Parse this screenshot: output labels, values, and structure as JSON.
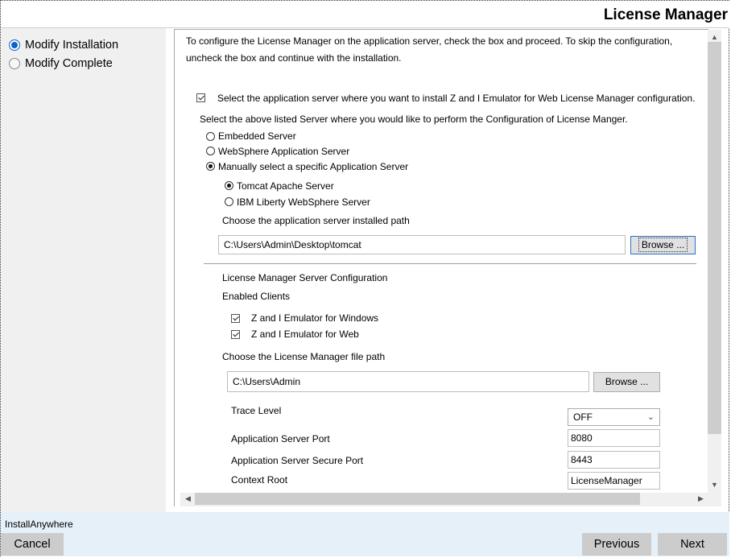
{
  "header": {
    "title": "License Manager"
  },
  "steps": [
    {
      "label": "Modify Installation",
      "active": true
    },
    {
      "label": "Modify Complete",
      "active": false
    }
  ],
  "content": {
    "intro": "To configure the License Manager on the application server, check the box and proceed. To skip the configuration,",
    "intro2": "uncheck the box and continue with the installation.",
    "select_server_checkbox": "Select the application server where you want to install Z and I Emulator for Web License Manager configuration.",
    "select_server_prompt": "Select the above listed Server where you would like to perform the Configuration of License Manger.",
    "server_options": [
      "Embedded Server",
      "WebSphere Application Server",
      "Manually select a specific Application Server"
    ],
    "selected_server_option": "Manually select a specific Application Server",
    "app_server_options": [
      "Tomcat Apache Server",
      "IBM Liberty WebSphere Server"
    ],
    "selected_app_server": "Tomcat Apache Server",
    "choose_path_label": "Choose the application server installed path",
    "app_server_path": "C:\\Users\\Admin\\Desktop\\tomcat",
    "browse_label": "Browse ...",
    "lm_config_label": "License Manager Server Configuration",
    "enabled_clients_label": "Enabled Clients",
    "clients": [
      "Z and I Emulator for Windows",
      "Z and I Emulator for Web"
    ],
    "lm_path_label": "Choose the License Manager file path",
    "lm_path": "C:\\Users\\Admin",
    "trace_level_label": "Trace Level",
    "trace_level_value": "OFF",
    "port_label": "Application Server Port",
    "port_value": "8080",
    "secure_port_label": "Application Server Secure Port",
    "secure_port_value": "8443",
    "context_root_label": "Context Root",
    "context_root_value": "LicenseManager"
  },
  "footer": {
    "brand": "InstallAnywhere",
    "cancel": "Cancel",
    "previous": "Previous",
    "next": "Next"
  },
  "icons": {
    "up": "▲",
    "down": "▼",
    "left": "◀",
    "right": "▶",
    "chevron": "⌄"
  }
}
